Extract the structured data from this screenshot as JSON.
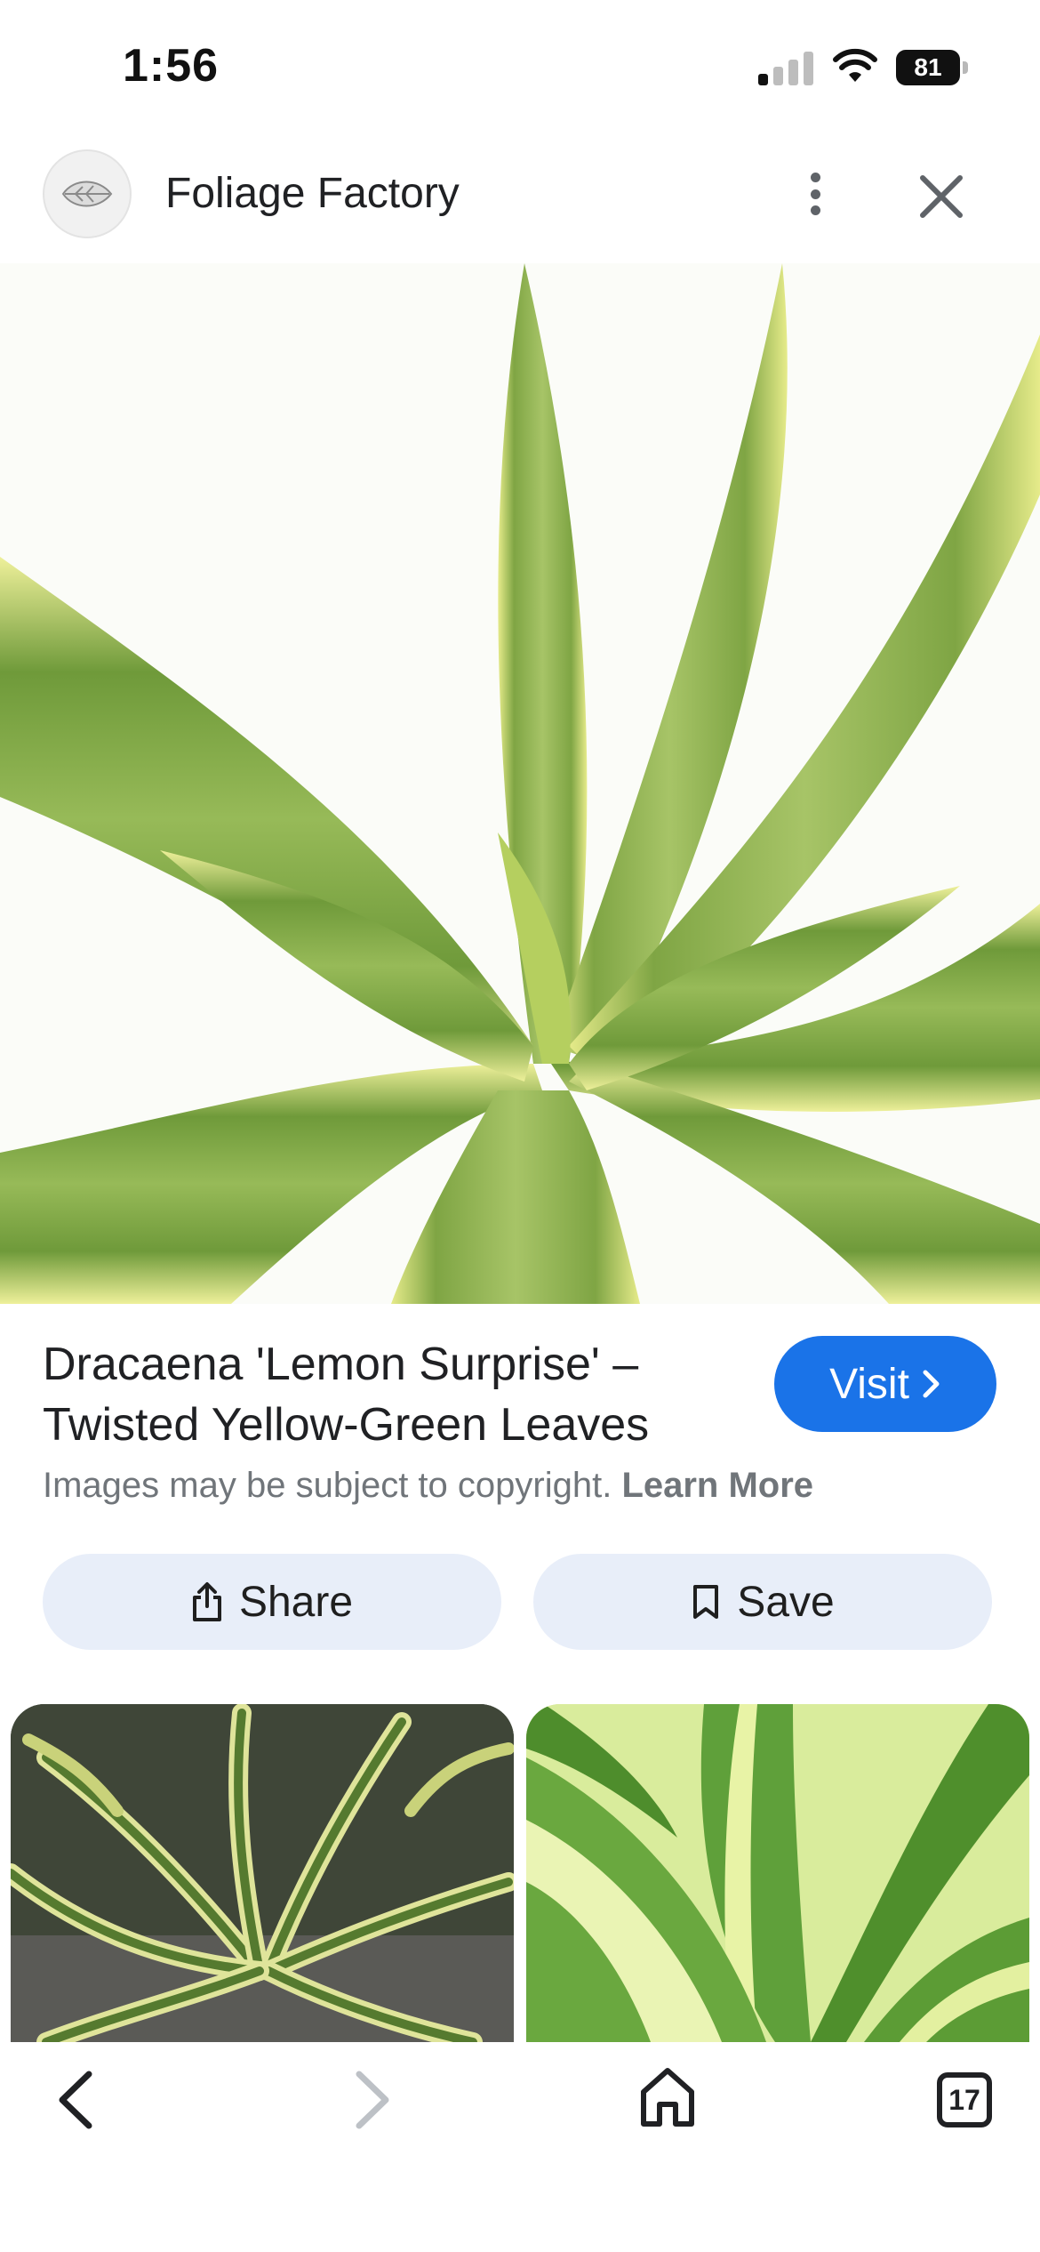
{
  "status_bar": {
    "time": "1:56",
    "battery": "81"
  },
  "header": {
    "site_name": "Foliage Factory"
  },
  "result": {
    "title": "Dracaena 'Lemon Surprise' – Twisted Yellow-Green Leaves",
    "visit_label": "Visit",
    "copyright_text": "Images may be subject to copyright.",
    "learn_more_label": "Learn More"
  },
  "actions": {
    "share_label": "Share",
    "save_label": "Save"
  },
  "bottom_nav": {
    "tab_count": "17"
  },
  "colors": {
    "accent": "#1a73e8",
    "pill_bg": "#e8eef9",
    "leaf_green": "#6e9a3c",
    "leaf_yellow": "#e9ec86"
  },
  "icons": [
    "signal-icon",
    "wifi-icon",
    "battery-icon",
    "more-vert-icon",
    "close-icon",
    "chevron-right-icon",
    "share-icon",
    "bookmark-icon",
    "back-arrow-icon",
    "forward-arrow-icon",
    "home-icon",
    "tabs-icon"
  ]
}
